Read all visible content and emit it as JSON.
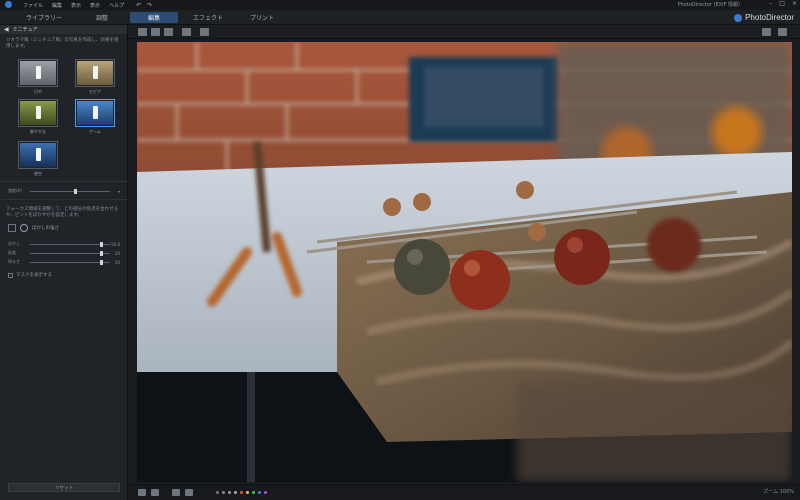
{
  "titlebar": {
    "menu": [
      "ファイル",
      "編集",
      "表示",
      "表示",
      "ヘルプ"
    ],
    "window_title": "PhotoDirector (EXIF 情報)"
  },
  "tabs": [
    "ライブラリー",
    "調整",
    "編集",
    "エフェクト",
    "プリント"
  ],
  "brand": "PhotoDirector",
  "panel": {
    "title": "ミニチュア",
    "description": "ジオラマ風（ミニチュア風）の写真を作成し、効果を適用します。",
    "presets": [
      {
        "label": "日中"
      },
      {
        "label": "セピア"
      },
      {
        "label": "鮮やかな"
      },
      {
        "label": "ゲーム"
      },
      {
        "label": "夜空"
      }
    ],
    "intensity_label": "強度(A)",
    "focus_note": "フォーカス領域を調整して、どの部分の焦点を合わせるか、ピントをぼかすかを設定します。",
    "blur_label": "ぼかしの強さ",
    "sliders": [
      {
        "label": "ぼかし",
        "value": "50.0",
        "pos": 0.88
      },
      {
        "label": "彩度",
        "value": "20",
        "pos": 0.88
      },
      {
        "label": "明るさ",
        "value": "20",
        "pos": 0.88
      }
    ],
    "checkbox_label": "マスクを表示する",
    "reset": "リセット"
  },
  "bottom": {
    "zoom": "ズーム 100%"
  },
  "colors": {
    "accent": "#3a7bd5",
    "active_tab": "#2c4d73"
  }
}
